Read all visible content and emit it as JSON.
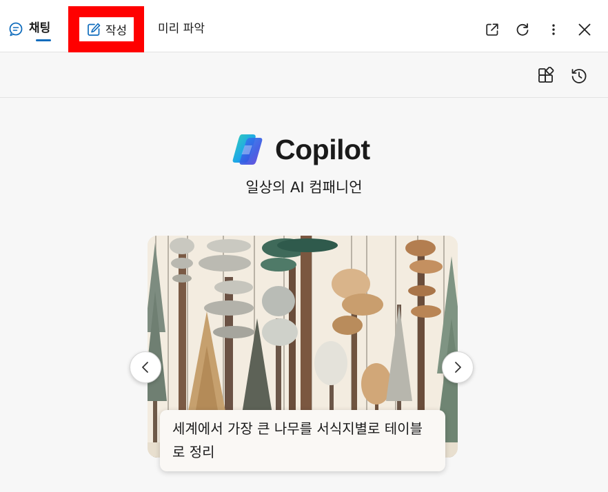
{
  "tabs": {
    "chat": "채팅",
    "compose": "작성",
    "insight": "미리 파악"
  },
  "brand": {
    "name": "Copilot",
    "tagline": "일상의 AI 컴패니언"
  },
  "carousel": {
    "caption": "세계에서 가장 큰 나무를 서식지별로 테이블로 정리",
    "image": "illustrated row of tall trees (sequoia, pine, fir, oak) on cream background"
  },
  "icons": {
    "chat": "chat-bubble-icon",
    "compose": "compose-edit-icon",
    "open_external": "open-in-new-window-icon",
    "refresh": "refresh-icon",
    "more": "more-vertical-icon",
    "close": "close-icon",
    "plugins": "plugins-icon",
    "history": "history-icon",
    "prev": "chevron-left-icon",
    "next": "chevron-right-icon"
  },
  "colors": {
    "accent": "#0f6cbd",
    "highlight": "#ff0000",
    "page_bg": "#f7f7f7"
  }
}
